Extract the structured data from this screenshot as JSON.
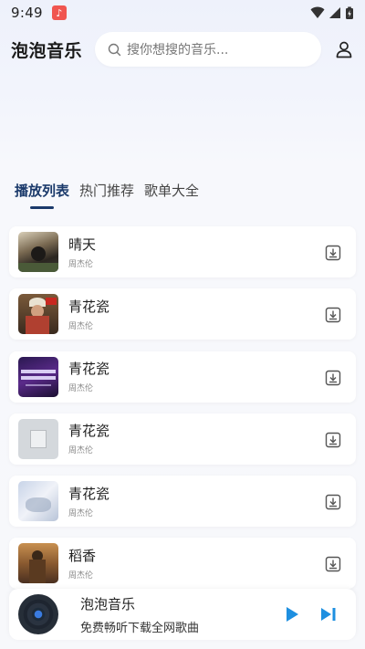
{
  "status": {
    "time": "9:49"
  },
  "header": {
    "title": "泡泡音乐",
    "search_placeholder": "搜你想搜的音乐..."
  },
  "tabs": [
    {
      "label": "播放列表",
      "active": true
    },
    {
      "label": "热门推荐",
      "active": false
    },
    {
      "label": "歌单大全",
      "active": false
    }
  ],
  "songs": [
    {
      "title": "晴天",
      "artist": "周杰伦"
    },
    {
      "title": "青花瓷",
      "artist": "周杰伦"
    },
    {
      "title": "青花瓷",
      "artist": "周杰伦"
    },
    {
      "title": "青花瓷",
      "artist": "周杰伦"
    },
    {
      "title": "青花瓷",
      "artist": "周杰伦"
    },
    {
      "title": "稻香",
      "artist": "周杰伦"
    }
  ],
  "player": {
    "title": "泡泡音乐",
    "subtitle": "免费畅听下载全网歌曲"
  },
  "colors": {
    "accent": "#1b3a6b",
    "play": "#1e8fe0"
  }
}
